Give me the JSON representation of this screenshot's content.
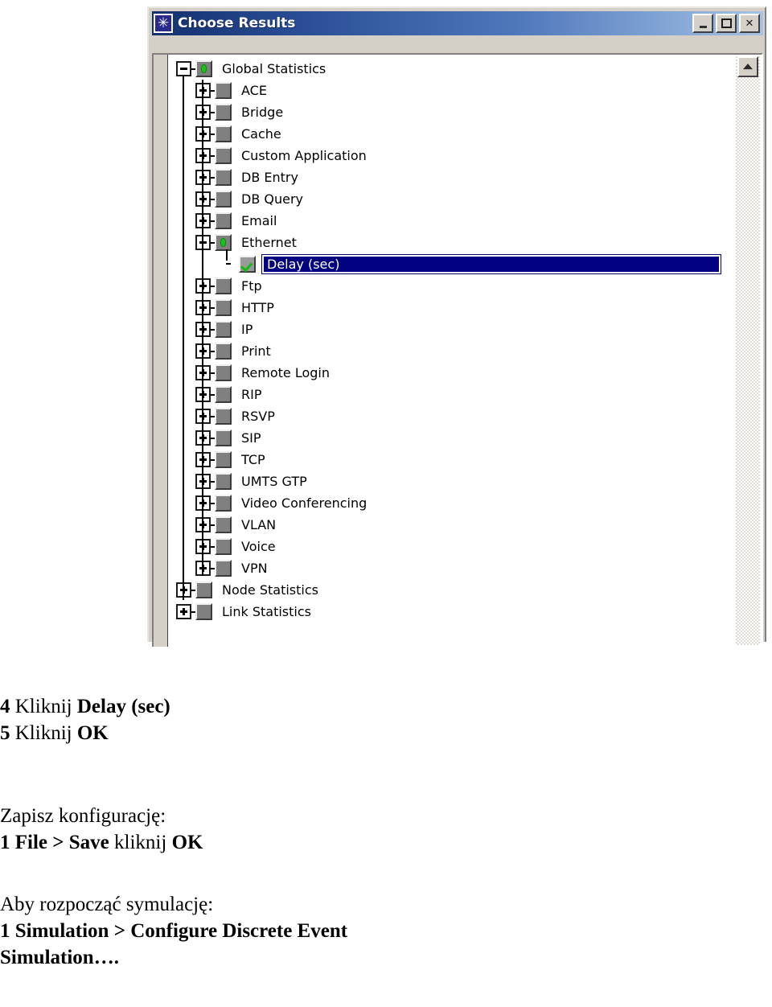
{
  "window": {
    "title": "Choose Results",
    "icon": "star-burst-icon",
    "buttons": {
      "minimize": "_",
      "maximize": "□",
      "close": "×"
    },
    "accent_titlebar_dark": "#14306e",
    "accent_titlebar_light": "#a8c2e5",
    "selection_color": "#000080",
    "face_color": "#d4d0c8"
  },
  "tree": {
    "scrollbar": {
      "up_arrow": "▲"
    },
    "items": [
      {
        "label": "Global Statistics",
        "level": 0,
        "state": "dot",
        "expander": "minus"
      },
      {
        "label": "ACE",
        "level": 1,
        "state": "empty",
        "expander": "plus"
      },
      {
        "label": "Bridge",
        "level": 1,
        "state": "empty",
        "expander": "plus"
      },
      {
        "label": "Cache",
        "level": 1,
        "state": "empty",
        "expander": "plus"
      },
      {
        "label": "Custom Application",
        "level": 1,
        "state": "empty",
        "expander": "plus"
      },
      {
        "label": "DB Entry",
        "level": 1,
        "state": "empty",
        "expander": "plus"
      },
      {
        "label": "DB Query",
        "level": 1,
        "state": "empty",
        "expander": "plus"
      },
      {
        "label": "Email",
        "level": 1,
        "state": "empty",
        "expander": "plus"
      },
      {
        "label": "Ethernet",
        "level": 1,
        "state": "dot",
        "expander": "minus"
      },
      {
        "label": "Delay (sec)",
        "level": 2,
        "state": "check",
        "expander": "none",
        "selected": true
      },
      {
        "label": "Ftp",
        "level": 1,
        "state": "empty",
        "expander": "plus"
      },
      {
        "label": "HTTP",
        "level": 1,
        "state": "empty",
        "expander": "plus"
      },
      {
        "label": "IP",
        "level": 1,
        "state": "empty",
        "expander": "plus"
      },
      {
        "label": "Print",
        "level": 1,
        "state": "empty",
        "expander": "plus"
      },
      {
        "label": "Remote Login",
        "level": 1,
        "state": "empty",
        "expander": "plus"
      },
      {
        "label": "RIP",
        "level": 1,
        "state": "empty",
        "expander": "plus"
      },
      {
        "label": "RSVP",
        "level": 1,
        "state": "empty",
        "expander": "plus"
      },
      {
        "label": "SIP",
        "level": 1,
        "state": "empty",
        "expander": "plus"
      },
      {
        "label": "TCP",
        "level": 1,
        "state": "empty",
        "expander": "plus"
      },
      {
        "label": "UMTS GTP",
        "level": 1,
        "state": "empty",
        "expander": "plus"
      },
      {
        "label": "Video Conferencing",
        "level": 1,
        "state": "empty",
        "expander": "plus"
      },
      {
        "label": "VLAN",
        "level": 1,
        "state": "empty",
        "expander": "plus"
      },
      {
        "label": "Voice",
        "level": 1,
        "state": "empty",
        "expander": "plus"
      },
      {
        "label": "VPN",
        "level": 1,
        "state": "empty",
        "expander": "plus"
      },
      {
        "label": "Node Statistics",
        "level": 0,
        "state": "empty",
        "expander": "plus"
      },
      {
        "label": "Link Statistics",
        "level": 0,
        "state": "empty",
        "expander": "plus"
      }
    ]
  },
  "captions": {
    "step4_num": "4",
    "step4_verb": "Kliknij",
    "step4_target": "Delay (sec)",
    "step5_num": "5",
    "step5_verb": "Kliknij",
    "step5_target": "OK",
    "save_heading": "Zapisz konfigurację:",
    "save_num": "1",
    "save_menu": "File > Save",
    "save_verb": "kliknij",
    "save_target": "OK",
    "sim_heading": "Aby rozpocząć symulację:",
    "sim_num": "1",
    "sim_menu_a": "Simulation > Configure Discrete Event",
    "sim_menu_b": "Simulation…."
  }
}
